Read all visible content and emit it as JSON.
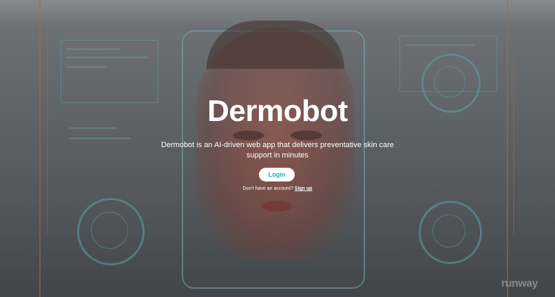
{
  "brand": {
    "title": "Dermobot"
  },
  "hero": {
    "description": "Dermobot is an AI-driven web app that delivers preventative skin care support in minutes",
    "login_label": "Login",
    "account_prompt": "Don't have an account?",
    "signup_label": "Sign up"
  },
  "watermark": {
    "text": "runway"
  },
  "colors": {
    "accent": "#2aa3b8",
    "text": "#ffffff",
    "hud": "#6ec8d7"
  }
}
